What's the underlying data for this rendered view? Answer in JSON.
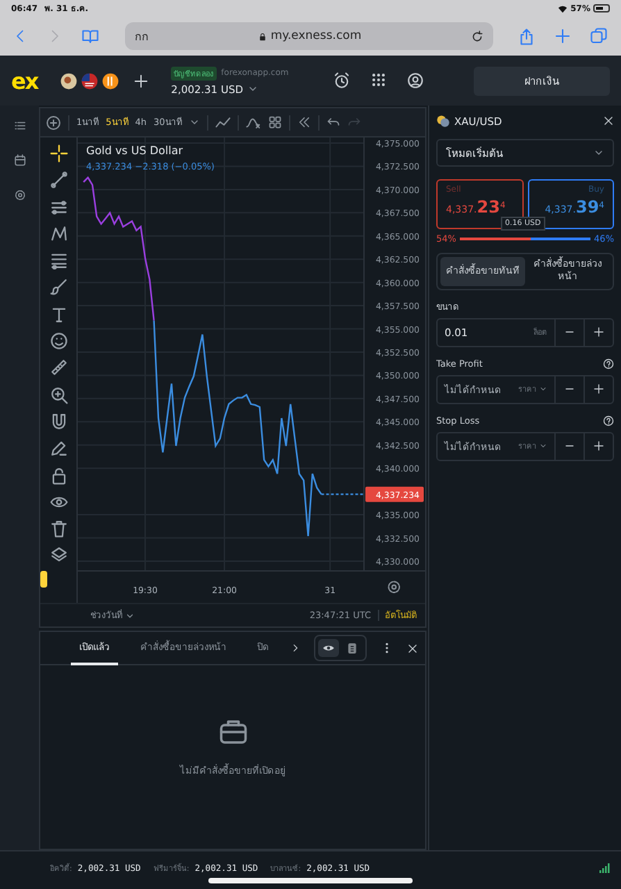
{
  "status_bar": {
    "time": "06:47",
    "date": "พ. 31 ธ.ค.",
    "battery": "57%"
  },
  "browser": {
    "text_size": "กก",
    "address": "my.exness.com"
  },
  "header": {
    "logo": "ex",
    "account_type": "บัญชีทดลอง",
    "server": "forexonapp.com",
    "balance": "2,002.31 USD",
    "deposit": "ฝากเงิน"
  },
  "chart_toolbar": {
    "timeframes": [
      {
        "label": "1นาที",
        "selected": false
      },
      {
        "label": "5นาที",
        "selected": true
      },
      {
        "label": "4h",
        "selected": false
      },
      {
        "label": "30นาที",
        "selected": false
      }
    ]
  },
  "drawing_tools": [
    {
      "selected": true
    },
    {
      "selected": false
    },
    {
      "selected": false
    },
    {
      "selected": false
    },
    {
      "selected": false
    },
    {
      "selected": false
    },
    {
      "selected": false
    },
    {
      "selected": false
    },
    {
      "selected": false
    },
    {
      "selected": false
    },
    {
      "selected": false
    },
    {
      "selected": false
    },
    {
      "selected": false
    },
    {
      "selected": false
    },
    {
      "selected": false
    },
    {
      "selected": false
    }
  ],
  "chart": {
    "quote": "4,337.234  −2.318 (−0.05%)",
    "current_price": "4,337.234",
    "chart_data": {
      "type": "line",
      "title": "Gold vs US Dollar",
      "categories": [
        null,
        null,
        null,
        null,
        null,
        null,
        null,
        null,
        null,
        null,
        null,
        null,
        null,
        null,
        "19:30",
        null,
        null,
        null,
        null,
        null,
        null,
        null,
        null,
        null,
        null,
        null,
        null,
        null,
        null,
        null,
        null,
        null,
        "21:00",
        null,
        null,
        null,
        null,
        null,
        null,
        null,
        null,
        null,
        null,
        null,
        null,
        null,
        null,
        null,
        null,
        null,
        null,
        null,
        null,
        null,
        null,
        null,
        "31"
      ],
      "series": [
        {
          "color": "#9b3fe0",
          "values": [
            4370.8,
            4371.3,
            4370.5,
            4367.1,
            4366.3,
            4366.9,
            4367.5,
            4366.3,
            4367.1,
            4366.0,
            4366.3,
            4366.6,
            4365.6,
            4366.0,
            4362.6,
            4360.3,
            4355.9,
            null,
            null,
            null,
            null,
            null,
            null,
            null,
            null,
            null,
            null,
            null,
            null,
            null,
            null,
            null,
            null,
            null,
            null,
            null,
            null,
            null,
            null,
            null,
            null,
            null,
            null,
            null,
            null,
            null,
            null,
            null,
            null,
            null,
            null,
            null,
            null,
            null,
            null,
            null,
            null
          ]
        },
        {
          "color": "#3b8de0",
          "values": [
            null,
            null,
            null,
            null,
            null,
            null,
            null,
            null,
            null,
            null,
            null,
            null,
            null,
            null,
            null,
            null,
            4355.9,
            4345.4,
            4341.7,
            4345.4,
            4349.1,
            4342.4,
            4345.4,
            4347.6,
            4348.8,
            4349.9,
            4352.1,
            4354.4,
            4349.9,
            4346.2,
            4342.4,
            4343.2,
            4345.4,
            4346.9,
            4347.3,
            4347.6,
            4347.6,
            4347.9,
            4346.9,
            4346.8,
            4346.6,
            4340.9,
            4340.2,
            4340.9,
            4339.4,
            4345.4,
            4342.4,
            4346.9,
            4343.2,
            4339.4,
            4338.7,
            4332.7,
            4339.4,
            4337.9,
            4337.2,
            null,
            null
          ]
        }
      ],
      "ylim": [
        4328.95,
        4375.6
      ],
      "grid": true,
      "yticks": [
        {
          "value": 4375,
          "label": "4,375.000"
        },
        {
          "value": 4372.5,
          "label": "4,372.500"
        },
        {
          "value": 4370,
          "label": "4,370.000"
        },
        {
          "value": 4367.5,
          "label": "4,367.500"
        },
        {
          "value": 4365,
          "label": "4,365.000"
        },
        {
          "value": 4362.5,
          "label": "4,362.500"
        },
        {
          "value": 4360,
          "label": "4,360.000"
        },
        {
          "value": 4357.5,
          "label": "4,357.500"
        },
        {
          "value": 4355,
          "label": "4,355.000"
        },
        {
          "value": 4352.5,
          "label": "4,352.500"
        },
        {
          "value": 4350,
          "label": "4,350.000"
        },
        {
          "value": 4347.5,
          "label": "4,347.500"
        },
        {
          "value": 4345,
          "label": "4,345.000"
        },
        {
          "value": 4342.5,
          "label": "4,342.500"
        },
        {
          "value": 4340,
          "label": "4,340.000"
        },
        {
          "value": 4335,
          "label": "4,335.000"
        },
        {
          "value": 4332.5,
          "label": "4,332.500"
        },
        {
          "value": 4330,
          "label": "4,330.000"
        }
      ]
    }
  },
  "chart_footer": {
    "range": "ช่วงวันที่",
    "time": "23:47:21 UTC",
    "auto": "อัตโนมัติ"
  },
  "positions": {
    "tabs": [
      {
        "label": "เปิดแล้ว",
        "selected": true
      },
      {
        "label": "คำสั่งซื้อขายล่วงหน้า",
        "selected": false
      },
      {
        "label": "ปิด",
        "selected": false
      }
    ],
    "view_toggle": [
      {
        "selected": true
      },
      {
        "selected": false
      }
    ],
    "empty_message": "ไม่มีคำสั่งซื้อขายที่เปิดอยู่"
  },
  "account_summary": [
    {
      "label": "อิควิตี้:",
      "value": "2,002.31 USD"
    },
    {
      "label": "ฟรีมาร์จิ้น:",
      "value": "2,002.31 USD"
    },
    {
      "label": "บาลานซ์:",
      "value": "2,002.31 USD"
    }
  ],
  "order_panel": {
    "symbol": "XAU/USD",
    "mode": "โหมดเริ่มต้น",
    "sell": {
      "label": "Sell",
      "price": "4,337.**23**$^{4}$"
    },
    "buy": {
      "label": "Buy",
      "price": "4,337.**39**$^{4}$"
    },
    "spread": "0.16 USD",
    "sentiment": {
      "sell": "54%",
      "buy": "46%",
      "level": 0.54
    },
    "order_types": [
      {
        "label": "คำสั่งซื้อขายทันที",
        "selected": true
      },
      {
        "label": "คำสั่งซื้อขายล่วงหน้า",
        "selected": false
      }
    ],
    "fields": [
      {
        "kind": "size",
        "label": "ขนาด",
        "value": "0.01",
        "unit": "ล็อต",
        "help": false
      },
      {
        "kind": "price",
        "label": "Take Profit",
        "placeholder": "ไม่ได้กำหนด",
        "unit": "ราคา",
        "help": true
      },
      {
        "kind": "price",
        "label": "Stop Loss",
        "placeholder": "ไม่ได้กำหนด",
        "unit": "ราคา",
        "help": true
      }
    ]
  }
}
